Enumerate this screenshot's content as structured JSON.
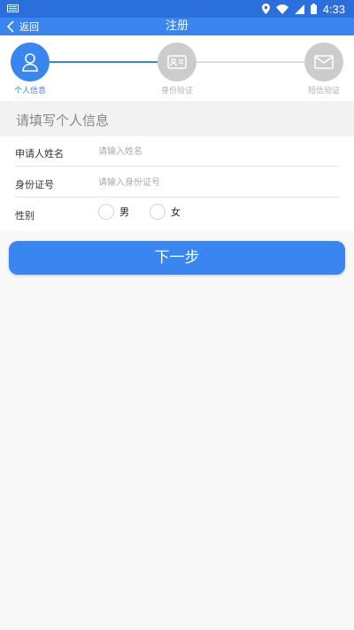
{
  "status_bar": {
    "time": "4:33",
    "icons": [
      "keyboard-icon",
      "location-icon",
      "wifi-icon",
      "signal-icon",
      "battery-icon"
    ]
  },
  "title_bar": {
    "back_label": "返回",
    "title": "注册",
    "color": "#3a86f0"
  },
  "steps": [
    {
      "label": "个人信息",
      "icon": "person-icon",
      "active": true
    },
    {
      "label": "身份验证",
      "icon": "id-card-icon",
      "active": false
    },
    {
      "label": "短信验证",
      "icon": "envelope-icon",
      "active": false
    }
  ],
  "section": {
    "title": "请填写个人信息"
  },
  "form": {
    "name": {
      "label": "申请人姓名",
      "placeholder": "请输入姓名",
      "value": ""
    },
    "id_number": {
      "label": "身份证号",
      "placeholder": "请输入身份证号",
      "value": ""
    },
    "gender": {
      "label": "性别",
      "options": [
        "男",
        "女"
      ]
    }
  },
  "next_button": {
    "label": "下一步"
  },
  "colors": {
    "accent": "#3a86f0",
    "status_bar": "#2a6fdb",
    "inactive_step": "#cccccc"
  }
}
